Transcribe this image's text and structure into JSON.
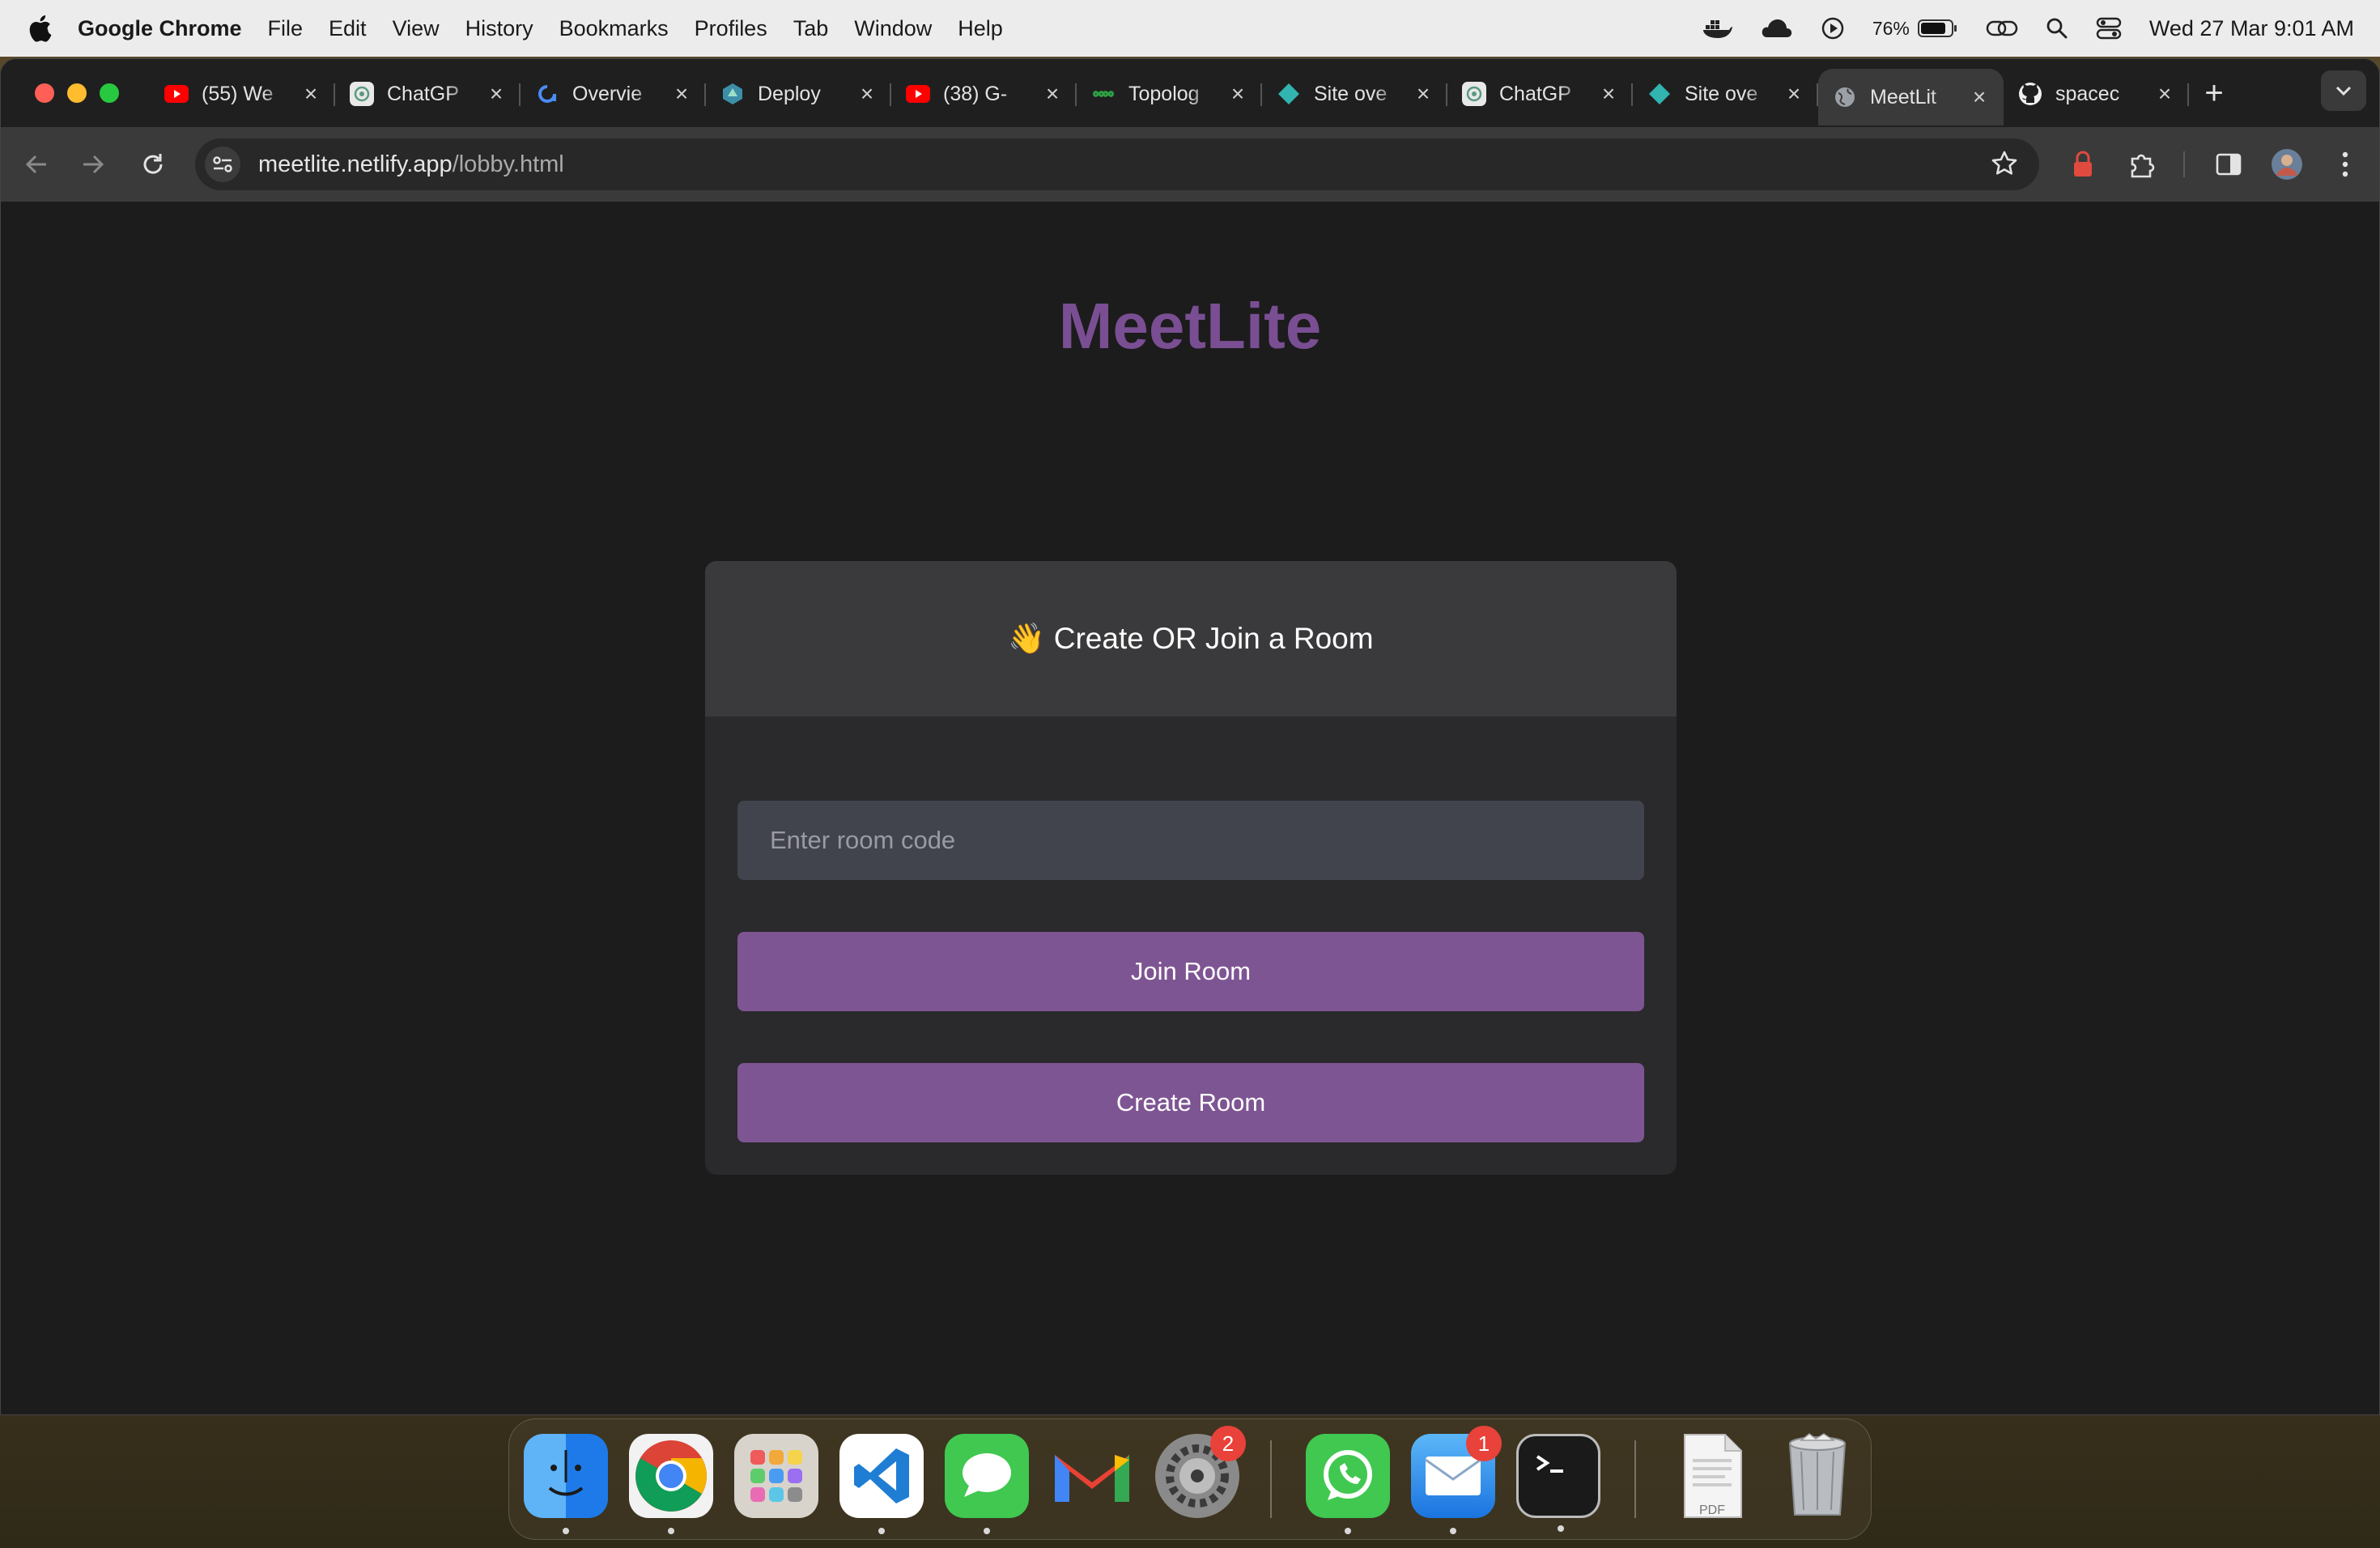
{
  "menubar": {
    "app_name": "Google Chrome",
    "items": [
      "File",
      "Edit",
      "View",
      "History",
      "Bookmarks",
      "Profiles",
      "Tab",
      "Window",
      "Help"
    ],
    "battery_percent": "76%",
    "datetime": "Wed 27 Mar  9:01 AM"
  },
  "tabs": [
    {
      "title": "(55) We",
      "icon": "youtube-icon"
    },
    {
      "title": "ChatGP",
      "icon": "chatgpt-icon"
    },
    {
      "title": "Overvie",
      "icon": "appwrite-icon"
    },
    {
      "title": "Deploy",
      "icon": "deploy-icon"
    },
    {
      "title": "(38) G-",
      "icon": "youtube-icon"
    },
    {
      "title": "Topolog",
      "icon": "topology-icon"
    },
    {
      "title": "Site ove",
      "icon": "netlify-icon"
    },
    {
      "title": "ChatGP",
      "icon": "chatgpt-icon"
    },
    {
      "title": "Site ove",
      "icon": "netlify-icon"
    },
    {
      "title": "MeetLit",
      "icon": "globe-icon",
      "active": true
    },
    {
      "title": "spacec",
      "icon": "github-icon"
    }
  ],
  "address_bar": {
    "host": "meetlite.netlify.app",
    "path": "/lobby.html"
  },
  "page": {
    "brand": "MeetLite",
    "card_title": "👋 Create OR Join a Room",
    "room_input_placeholder": "Enter room code",
    "join_label": "Join Room",
    "create_label": "Create Room"
  },
  "colors": {
    "brand": "#7a4e93",
    "button": "#7e5593",
    "card": "#2a2a2c",
    "card_header": "#3a3a3c",
    "input": "#41434d"
  },
  "dock": {
    "apps": [
      "finder-icon",
      "chrome-icon",
      "launchpad-icon",
      "vscode-icon",
      "messages-icon",
      "gmail-icon",
      "system-settings-icon",
      "whatsapp-icon",
      "mail-icon",
      "terminal-icon",
      "pdf-document-icon",
      "trash-icon"
    ],
    "system_settings_badge": "2",
    "mail_badge": "1",
    "pdf_label": "PDF"
  }
}
